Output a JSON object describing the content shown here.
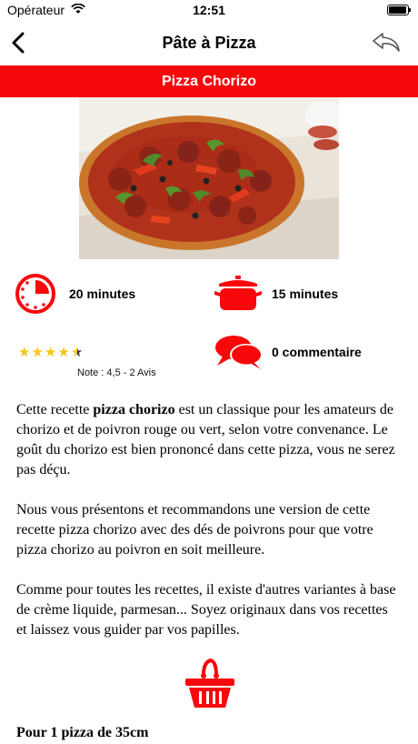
{
  "status": {
    "carrier": "Opérateur",
    "time": "12:51"
  },
  "nav": {
    "title": "Pâte à Pizza"
  },
  "recipe": {
    "name": "Pizza Chorizo",
    "prep_time": "20 minutes",
    "cook_time": "15 minutes",
    "rating": 4.5,
    "rating_note": "Note : 4,5 - 2 Avis",
    "comments": "0 commentaire",
    "paragraph1_pre": "Cette recette ",
    "paragraph1_bold": "pizza chorizo",
    "paragraph1_post": " est un classique pour les amateurs de chorizo et de poivron rouge ou vert, selon votre convenance. Le goût du chorizo est bien prononcé dans cette pizza, vous ne serez pas déçu.",
    "paragraph2": "Nous vous présentons et recommandons une version de cette recette pizza chorizo avec des dés de poivrons pour que votre pizza chorizo au poivron en soit meilleure.",
    "paragraph3": "Comme pour toutes les recettes, il existe d'autres variantes à base de crème liquide, parmesan... Soyez originaux dans vos recettes et laissez vous guider par vos papilles.",
    "servings": "Pour 1 pizza de 35cm"
  },
  "colors": {
    "accent": "#f8070b",
    "star": "#f5c518"
  },
  "icons": {
    "back": "chevron-left-icon",
    "share": "reply-arrow-icon",
    "timer": "timer-icon",
    "pot": "cooking-pot-icon",
    "comments": "speech-bubbles-icon",
    "basket": "shopping-basket-icon"
  }
}
